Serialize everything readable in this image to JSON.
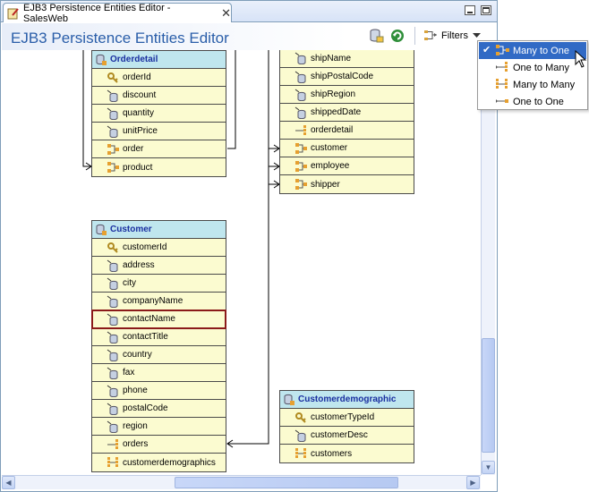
{
  "tab": {
    "label": "EJB3 Persistence Entities Editor - SalesWeb",
    "close": "✕"
  },
  "editor": {
    "title": "EJB3 Persistence Entities Editor",
    "filters_label": "Filters"
  },
  "entities": {
    "orderdetail": {
      "name": "Orderdetail",
      "fields": [
        "orderId",
        "discount",
        "quantity",
        "unitPrice",
        "order",
        "product"
      ]
    },
    "order": {
      "fields": [
        "shipName",
        "shipPostalCode",
        "shipRegion",
        "shippedDate",
        "orderdetail",
        "customer",
        "employee",
        "shipper"
      ]
    },
    "customer": {
      "name": "Customer",
      "fields": [
        "customerId",
        "address",
        "city",
        "companyName",
        "contactName",
        "contactTitle",
        "country",
        "fax",
        "phone",
        "postalCode",
        "region",
        "orders",
        "customerdemographics"
      ]
    },
    "customerdemographic": {
      "name": "Customerdemographic",
      "fields": [
        "customerTypeId",
        "customerDesc",
        "customers"
      ]
    }
  },
  "filter_menu": {
    "items": [
      "Many to One",
      "One to Many",
      "Many to Many",
      "One to One"
    ],
    "checked": "Many to One"
  },
  "colors": {
    "title": "#2a5ea9",
    "entity_header": "#bfe6ee",
    "entity_body": "#fbfbd0",
    "selection": "#316ac5"
  }
}
